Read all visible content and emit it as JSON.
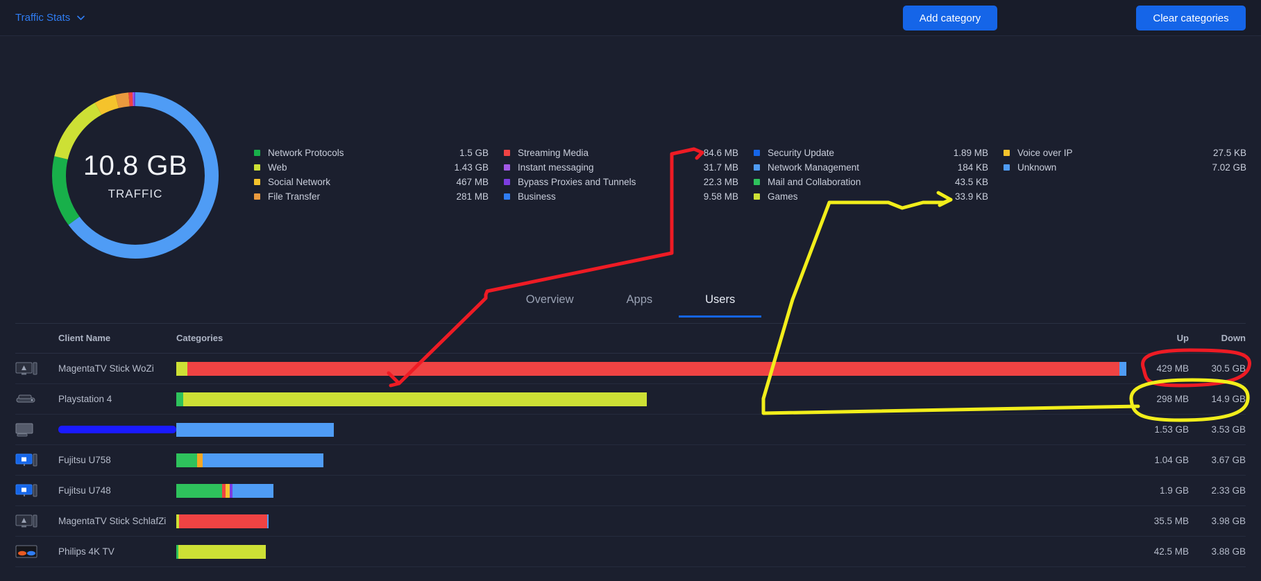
{
  "header": {
    "menu_label": "Traffic Stats",
    "menu_icon": "chevron-down-icon",
    "add_category_label": "Add category",
    "clear_categories_label": "Clear categories"
  },
  "donut": {
    "total": "10.8 GB",
    "sublabel": "TRAFFIC"
  },
  "legend_columns": [
    {
      "items": [
        {
          "label": "Network Protocols",
          "value": "1.5 GB",
          "color": "#18b04a"
        },
        {
          "label": "Web",
          "value": "1.43 GB",
          "color": "#cde035"
        },
        {
          "label": "Social Network",
          "value": "467 MB",
          "color": "#f5c32c"
        },
        {
          "label": "File Transfer",
          "value": "281 MB",
          "color": "#ea9a3e"
        }
      ]
    },
    {
      "items": [
        {
          "label": "Streaming Media",
          "value": "84.6 MB",
          "color": "#ef4343"
        },
        {
          "label": "Instant messaging",
          "value": "31.7 MB",
          "color": "#a259e6"
        },
        {
          "label": "Bypass Proxies and Tunnels",
          "value": "22.3 MB",
          "color": "#7c3ce0"
        },
        {
          "label": "Business",
          "value": "9.58 MB",
          "color": "#2f7df4"
        }
      ]
    },
    {
      "items": [
        {
          "label": "Security Update",
          "value": "1.89 MB",
          "color": "#1565e8"
        },
        {
          "label": "Network Management",
          "value": "184 KB",
          "color": "#4f9cf5"
        },
        {
          "label": "Mail and Collaboration",
          "value": "43.5 KB",
          "color": "#2ec25c"
        },
        {
          "label": "Games",
          "value": "33.9 KB",
          "color": "#cde035"
        }
      ]
    },
    {
      "items": [
        {
          "label": "Voice over IP",
          "value": "27.5 KB",
          "color": "#f5c32c"
        },
        {
          "label": "Unknown",
          "value": "7.02 GB",
          "color": "#4f9cf5"
        }
      ]
    }
  ],
  "tabs": [
    {
      "label": "Overview",
      "active": false
    },
    {
      "label": "Apps",
      "active": false
    },
    {
      "label": "Users",
      "active": true
    }
  ],
  "table": {
    "headers": {
      "client_name": "Client Name",
      "categories": "Categories",
      "up": "Up",
      "down": "Down"
    },
    "rows": [
      {
        "name": "MagentaTV Stick WoZi",
        "redacted": false,
        "icon": "monitor-icon",
        "up": "429 MB",
        "down": "30.5 GB",
        "bar_width_pct": 100,
        "segments": [
          {
            "color": "#cde035",
            "pct": 1.2
          },
          {
            "color": "#ef4343",
            "pct": 98.1
          },
          {
            "color": "#4f9cf5",
            "pct": 0.7
          }
        ]
      },
      {
        "name": "Playstation 4",
        "redacted": false,
        "icon": "console-icon",
        "up": "298 MB",
        "down": "14.9 GB",
        "bar_width_pct": 49.5,
        "segments": [
          {
            "color": "#2ec25c",
            "pct": 1.5
          },
          {
            "color": "#cde035",
            "pct": 98.5
          }
        ]
      },
      {
        "name": "",
        "redacted": true,
        "icon": "desktop-icon",
        "up": "1.53 GB",
        "down": "3.53 GB",
        "bar_width_pct": 16.6,
        "segments": [
          {
            "color": "#4f9cf5",
            "pct": 100
          }
        ]
      },
      {
        "name": "Fujitsu U758",
        "redacted": false,
        "icon": "pc-windows-icon",
        "up": "1.04 GB",
        "down": "3.67 GB",
        "bar_width_pct": 15.5,
        "segments": [
          {
            "color": "#2ec25c",
            "pct": 14
          },
          {
            "color": "#f5a623",
            "pct": 4
          },
          {
            "color": "#4f9cf5",
            "pct": 82
          }
        ]
      },
      {
        "name": "Fujitsu U748",
        "redacted": false,
        "icon": "pc-windows-icon",
        "up": "1.9 GB",
        "down": "2.33 GB",
        "bar_width_pct": 10.2,
        "segments": [
          {
            "color": "#2ec25c",
            "pct": 47
          },
          {
            "color": "#ef4343",
            "pct": 4
          },
          {
            "color": "#f5c32c",
            "pct": 4
          },
          {
            "color": "#7c3ce0",
            "pct": 3
          },
          {
            "color": "#4f9cf5",
            "pct": 42
          }
        ]
      },
      {
        "name": "MagentaTV Stick SchlafZi",
        "redacted": false,
        "icon": "monitor-icon",
        "up": "35.5 MB",
        "down": "3.98 GB",
        "bar_width_pct": 9.7,
        "segments": [
          {
            "color": "#cde035",
            "pct": 3
          },
          {
            "color": "#ef4343",
            "pct": 96
          },
          {
            "color": "#4f9cf5",
            "pct": 1
          }
        ]
      },
      {
        "name": "Philips 4K TV",
        "redacted": false,
        "icon": "tv-icon",
        "up": "42.5 MB",
        "down": "3.88 GB",
        "bar_width_pct": 9.4,
        "segments": [
          {
            "color": "#2ec25c",
            "pct": 2
          },
          {
            "color": "#cde035",
            "pct": 98
          }
        ]
      }
    ]
  },
  "annotations": {
    "red_marker_color": "#ee1b24",
    "yellow_marker_color": "#f2ee1b",
    "blue_redaction_color": "#1a1aff"
  },
  "chart_data": {
    "type": "pie",
    "title": "Traffic",
    "total": "10.8 GB",
    "legend_position": "right",
    "categories": [
      "Unknown",
      "Network Protocols",
      "Web",
      "Social Network",
      "File Transfer",
      "Streaming Media",
      "Instant messaging",
      "Bypass Proxies and Tunnels",
      "Business",
      "Security Update",
      "Network Management",
      "Mail and Collaboration",
      "Games",
      "Voice over IP"
    ],
    "values": [
      "7.02 GB",
      "1.5 GB",
      "1.43 GB",
      "467 MB",
      "281 MB",
      "84.6 MB",
      "31.7 MB",
      "22.3 MB",
      "9.58 MB",
      "1.89 MB",
      "184 KB",
      "43.5 KB",
      "33.9 KB",
      "27.5 KB"
    ],
    "colors": [
      "#4f9cf5",
      "#18b04a",
      "#cde035",
      "#f5c32c",
      "#ea9a3e",
      "#ef4343",
      "#a259e6",
      "#7c3ce0",
      "#2f7df4",
      "#1565e8",
      "#4f9cf5",
      "#2ec25c",
      "#cde035",
      "#f5c32c"
    ]
  }
}
